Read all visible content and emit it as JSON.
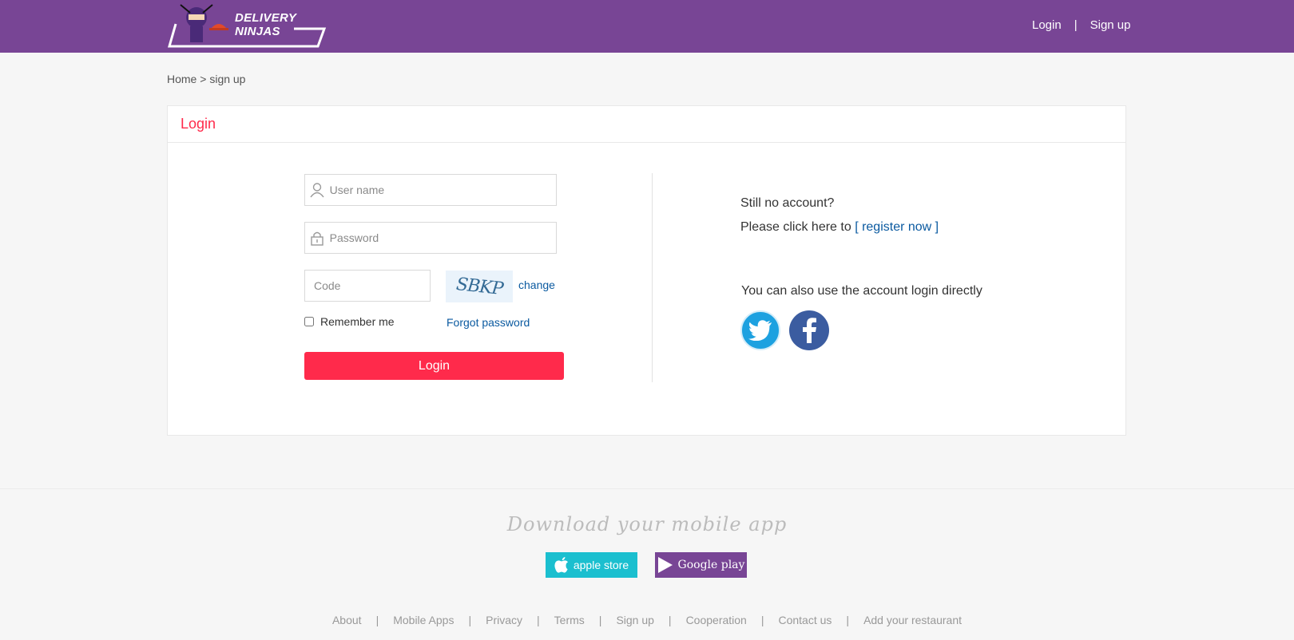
{
  "brand": {
    "name": "DELIVERY NINJAS"
  },
  "top_nav": {
    "login": "Login",
    "separator": "|",
    "signup": "Sign up"
  },
  "breadcrumb": {
    "home": "Home",
    "separator": ">",
    "current": "sign up"
  },
  "login_card": {
    "title": "Login",
    "username_placeholder": "User name",
    "password_placeholder": "Password",
    "code_placeholder": "Code",
    "captcha_text": "SBKP",
    "change_label": "change",
    "remember_label": "Remember me",
    "forgot_label": "Forgot password",
    "login_button": "Login"
  },
  "register_panel": {
    "line1": "Still no account?",
    "line2_prefix": "Please click here to",
    "register_link": "[ register now ]",
    "social_line": "You can also use the account login directly"
  },
  "footer": {
    "download_title": "Download your mobile app",
    "apple_label": "apple store",
    "google_label": "Google play",
    "links": [
      "About",
      "Mobile Apps",
      "Privacy",
      "Terms",
      "Sign up",
      "Cooperation",
      "Contact us",
      "Add your restaurant"
    ],
    "link_separator": "|"
  },
  "colors": {
    "brand_purple": "#784595",
    "accent_red": "#ff2a4b",
    "link_blue": "#0b5aa0",
    "twitter": "#1da1e0",
    "facebook": "#3b5ca0",
    "apple_teal": "#1bbfcf"
  }
}
